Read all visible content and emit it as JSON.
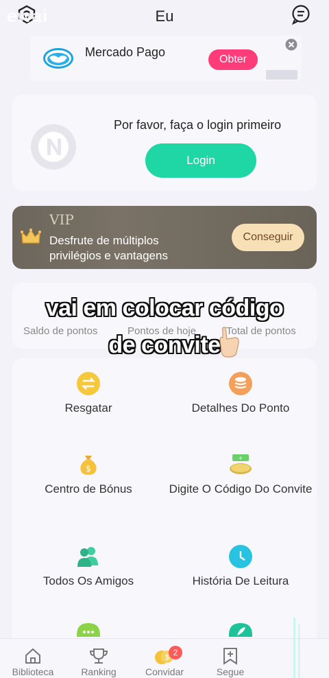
{
  "header": {
    "title": "Eu",
    "watermark": "ewai",
    "left_icon": "settings-hex-icon",
    "right_icon": "message-icon"
  },
  "ad": {
    "brand": "Mercado Pago",
    "cta": "Obter",
    "icon": "handshake-icon"
  },
  "login": {
    "prompt": "Por favor, faça o login primeiro",
    "button": "Login",
    "avatar_icon": "n-logo-avatar"
  },
  "vip": {
    "title": "VIP",
    "description": "Desfrute de múltiplos privilégios e vantagens",
    "button": "Conseguir",
    "icon": "crown-icon"
  },
  "points": {
    "labels": [
      "Saldo de pontos",
      "Pontos de hoje",
      "Total de pontos"
    ]
  },
  "overlay": {
    "line1": "vai em colocar código",
    "line2": "de convite"
  },
  "menu": {
    "items": [
      {
        "label": "Resgatar",
        "icon": "exchange-icon"
      },
      {
        "label": "Detalhes Do Ponto",
        "icon": "coins-stack-icon"
      },
      {
        "label": "Centro de Bónus",
        "icon": "money-bag-icon"
      },
      {
        "label": "Digite O Código Do Convite",
        "icon": "invite-code-icon"
      },
      {
        "label": "Todos Os Amigos",
        "icon": "friends-icon"
      },
      {
        "label": "História De Leitura",
        "icon": "clock-icon"
      }
    ]
  },
  "tabs": [
    {
      "label": "Biblioteca",
      "icon": "home-icon"
    },
    {
      "label": "Ranking",
      "icon": "trophy-icon"
    },
    {
      "label": "Convidar",
      "icon": "coins-icon",
      "badge": "2"
    },
    {
      "label": "Segue",
      "icon": "bookmark-plus-icon"
    }
  ],
  "colors": {
    "accent": "#1fd6a5",
    "ad_cta": "#ff3c7a",
    "vip_bg": "#726b60",
    "vip_button": "#f7dfb6"
  }
}
